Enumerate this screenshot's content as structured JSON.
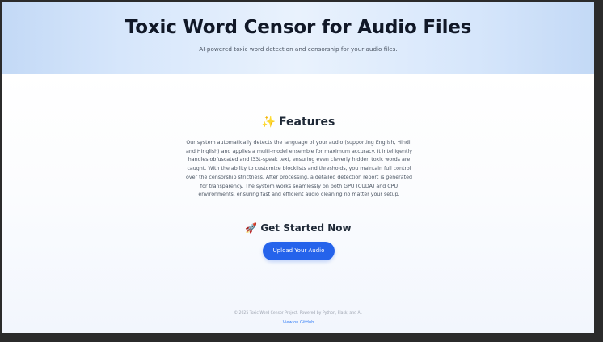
{
  "header": {
    "title": "Toxic Word Censor for Audio Files",
    "subtitle": "AI-powered toxic word detection and censorship for your audio files."
  },
  "features": {
    "icon": "sparkles-icon",
    "icon_glyph": "✨",
    "heading": "Features",
    "description": "Our system automatically detects the language of your audio (supporting English, Hindi, and Hinglish) and applies a multi-model ensemble for maximum accuracy. It intelligently handles obfuscated and l33t-speak text, ensuring even cleverly hidden toxic words are caught. With the ability to customize blocklists and thresholds, you maintain full control over the censorship strictness. After processing, a detailed detection report is generated for transparency. The system works seamlessly on both GPU (CUDA) and CPU environments, ensuring fast and efficient audio cleaning no matter your setup."
  },
  "get_started": {
    "icon": "rocket-icon",
    "icon_glyph": "🚀",
    "heading": "Get Started Now",
    "button_label": "Upload Your Audio"
  },
  "footer": {
    "copyright": "© 2025 Toxic Word Censor Project. Powered by Python, Flask, and AI.",
    "github_link": "View on GitHub"
  },
  "colors": {
    "accent": "#2563eb",
    "hero_gradient_edge": "#c3d9f6",
    "link": "#3b82f6"
  }
}
